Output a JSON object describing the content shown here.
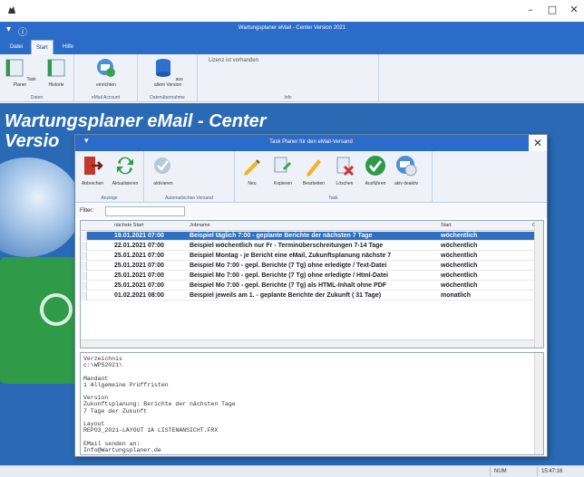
{
  "window": {
    "title": "Wartungsplaner eMail - Center Version 2021",
    "minimize_glyph": "–",
    "maximize_glyph": "□",
    "close_glyph": "✕"
  },
  "ribbon": {
    "tabs": [
      {
        "label": "Datei"
      },
      {
        "label": "Start"
      },
      {
        "label": "Hilfe"
      }
    ],
    "groups": {
      "daten": {
        "label": "Daten",
        "buttons": [
          {
            "label": "Task Planer",
            "icon": "task-planner-icon"
          },
          {
            "label": "Historie",
            "icon": "history-icon"
          }
        ]
      },
      "email_account": {
        "label": "eMail Account",
        "buttons": [
          {
            "label": "einrichten",
            "icon": "email-setup-icon"
          }
        ]
      },
      "datenuebernahme": {
        "label": "Datenübernahme",
        "buttons": [
          {
            "label": "aus altem Version",
            "icon": "database-import-icon"
          }
        ]
      },
      "info": {
        "label": "Info",
        "license_text": "Lizenz ist vorhanden"
      }
    }
  },
  "main": {
    "title_line1": "Wartungsplaner eMail - Center",
    "title_line2": "Versio"
  },
  "dialog": {
    "title": "Task Planer für den eMail-Versand",
    "close_glyph": "✕",
    "groups": {
      "anzeige": {
        "label": "Anzeige",
        "buttons": [
          {
            "label": "Abbrechen",
            "icon": "exit-icon"
          },
          {
            "label": "Aktualisieren",
            "icon": "refresh-icon"
          }
        ]
      },
      "auto": {
        "label": "Automatischen Versand",
        "buttons": [
          {
            "label": "aktivieren",
            "icon": "activate-icon"
          }
        ]
      },
      "task": {
        "label": "Task",
        "buttons": [
          {
            "label": "Neu",
            "icon": "new-icon"
          },
          {
            "label": "Kopieren",
            "icon": "copy-icon"
          },
          {
            "label": "Bearbeiten",
            "icon": "edit-icon"
          },
          {
            "label": "Löschen",
            "icon": "delete-icon"
          },
          {
            "label": "Ausführen",
            "icon": "execute-icon"
          },
          {
            "label": "akiv deaktiv",
            "icon": "toggle-active-icon"
          }
        ]
      }
    },
    "filter": {
      "label": "Filter:",
      "value": ""
    },
    "grid": {
      "columns": [
        "nächste Start",
        "Jobname",
        "Start",
        "C"
      ],
      "rows": [
        {
          "next_start": "19.01.2021 07:00",
          "jobname": "Beispiel täglich 7:00 - geplante Berichte der nächsten 7 Tage",
          "start": "wöchentlich",
          "selected": true
        },
        {
          "next_start": "22.01.2021 07:00",
          "jobname": "Beispiel wöchentlich nur Fr - Terminüberschreitungen 7-14 Tage",
          "start": "wöchentlich",
          "selected": false
        },
        {
          "next_start": "25.01.2021 07:00",
          "jobname": "Beispiel Montag - je Bericht eine eMail, Zukunftsplanung nächste 7",
          "start": "wöchentlich",
          "selected": false
        },
        {
          "next_start": "25.01.2021 07:00",
          "jobname": "Beispiel Mo 7:00 - gepl. Berichte (7 Tg)  ohne erledigte / Text-Datei",
          "start": "wöchentlich",
          "selected": false
        },
        {
          "next_start": "25.01.2021 07:00",
          "jobname": "Beispiel Mo 7:00 - gepl. Berichte (7 Tg)  ohne erledigte / Html-Datei",
          "start": "wöchentlich",
          "selected": false
        },
        {
          "next_start": "25.01.2021 07:00",
          "jobname": "Beispiel Mo 7:00 - gepl. Berichte (7 Tg)  als HTML-Inhalt ohne PDF",
          "start": "wöchentlich",
          "selected": false
        },
        {
          "next_start": "01.02.2021 08:00",
          "jobname": "Beispiel jeweils am 1. - geplante Berichte der Zukunft ( 31 Tage)",
          "start": "monatlich",
          "selected": false
        }
      ]
    },
    "info_text": "Verzeichnis\nc:\\WPS2021\\\n\nMandant\n1 Allgemeine Prüffristen\n\nVersion\nZukunftsplanung: Berichte der nächsten Tage\n7 Tage der Zukunft\n\nLayout\nREPO3_2021-LAYOUT 1A LISTENANSICHT.FRX\n\nEMail senden an:\nInfo@Wartungsplaner.de"
  },
  "statusbar": {
    "num": "NUM",
    "time": "15:47:16"
  },
  "colors": {
    "ribbon_blue": "#2b6cc8",
    "main_blue": "#2a6ab5",
    "selection": "#2e6fbf"
  }
}
